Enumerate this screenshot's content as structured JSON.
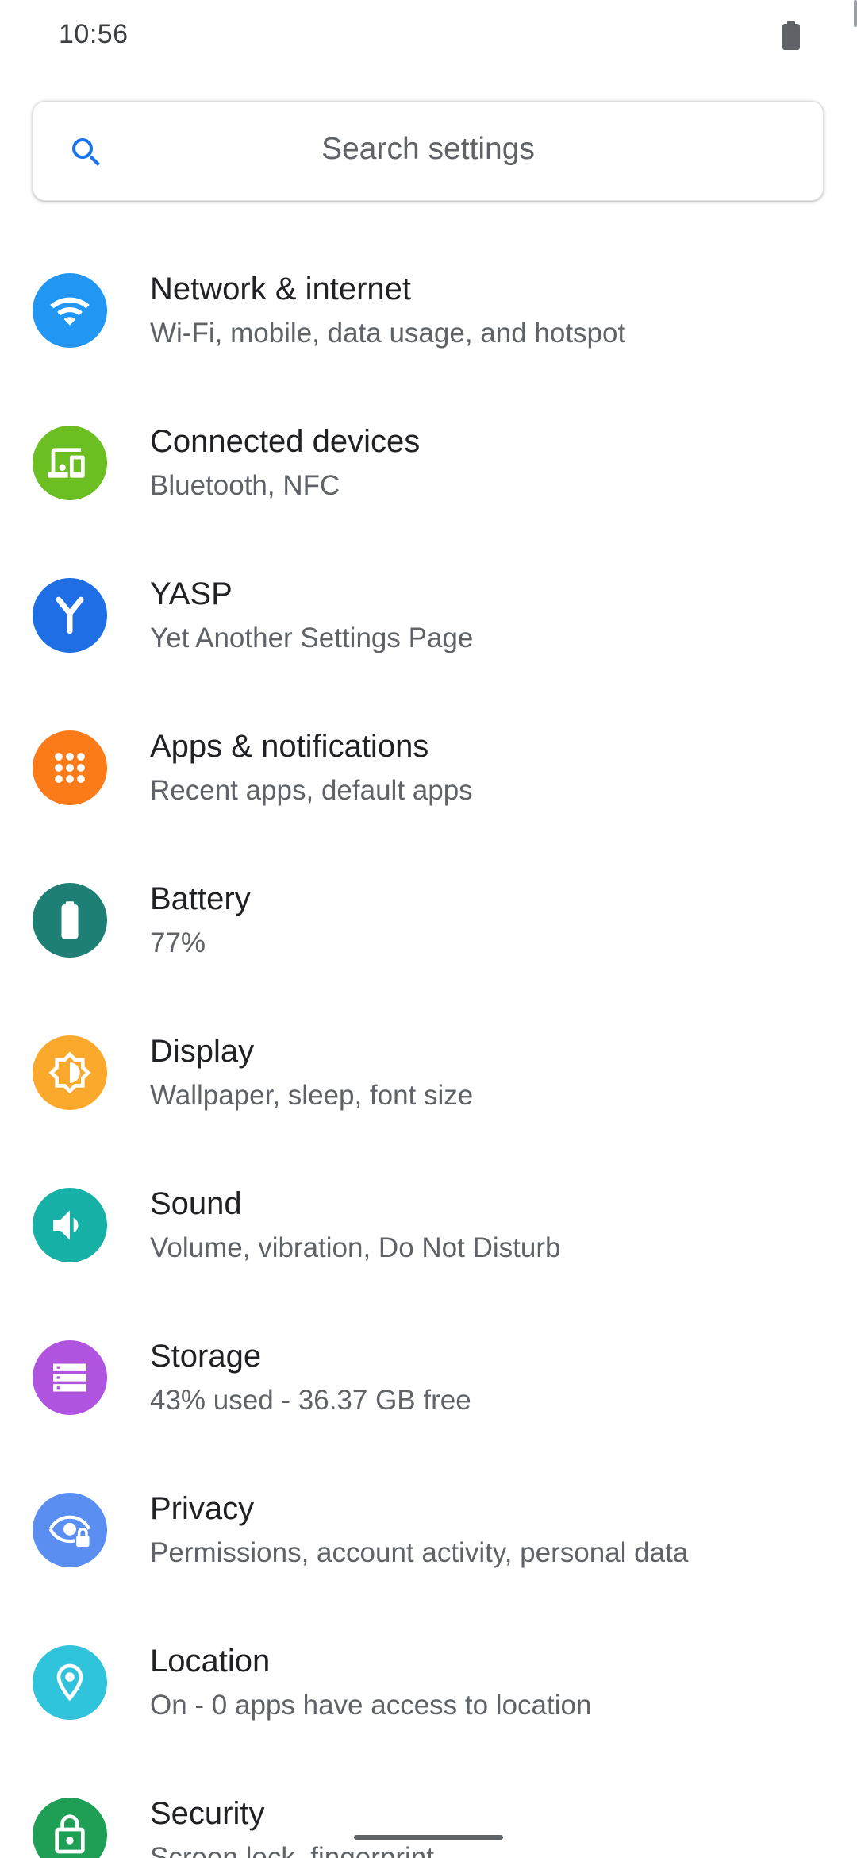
{
  "status_bar": {
    "time": "10:56"
  },
  "search": {
    "placeholder": "Search settings",
    "icon": "search-icon",
    "icon_color": "#1a73e8"
  },
  "items": [
    {
      "title": "Network & internet",
      "subtitle": "Wi-Fi, mobile, data usage, and hotspot",
      "icon": "wifi-icon",
      "color": "#2196f3"
    },
    {
      "title": "Connected devices",
      "subtitle": "Bluetooth, NFC",
      "icon": "connected-devices-icon",
      "color": "#6cbf23"
    },
    {
      "title": "YASP",
      "subtitle": "Yet Another Settings Page",
      "icon": "yasp-icon",
      "color": "#1e6ee6"
    },
    {
      "title": "Apps & notifications",
      "subtitle": "Recent apps, default apps",
      "icon": "apps-grid-icon",
      "color": "#fb7b19"
    },
    {
      "title": "Battery",
      "subtitle": "77%",
      "icon": "battery-icon",
      "color": "#1e7f74"
    },
    {
      "title": "Display",
      "subtitle": "Wallpaper, sleep, font size",
      "icon": "brightness-icon",
      "color": "#fba92c"
    },
    {
      "title": "Sound",
      "subtitle": "Volume, vibration, Do Not Disturb",
      "icon": "volume-icon",
      "color": "#17b0a6"
    },
    {
      "title": "Storage",
      "subtitle": "43% used - 36.37 GB free",
      "icon": "storage-icon",
      "color": "#b054e0"
    },
    {
      "title": "Privacy",
      "subtitle": "Permissions, account activity, personal data",
      "icon": "privacy-eye-icon",
      "color": "#5a8ef0"
    },
    {
      "title": "Location",
      "subtitle": "On - 0 apps have access to location",
      "icon": "location-pin-icon",
      "color": "#2fc4dc"
    },
    {
      "title": "Security",
      "subtitle": "Screen lock, fingerprint",
      "icon": "lock-icon",
      "color": "#1e9f55"
    }
  ]
}
